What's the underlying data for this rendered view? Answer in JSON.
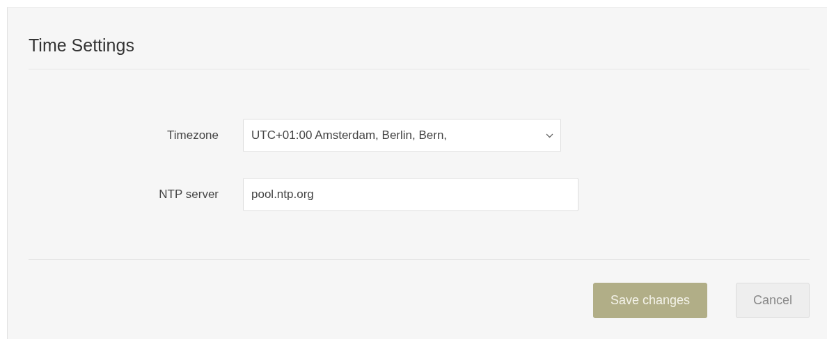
{
  "title": "Time Settings",
  "fields": [
    {
      "kind": "select",
      "label": "Timezone",
      "value": "UTC+01:00 Amsterdam, Berlin, Bern,"
    },
    {
      "kind": "text",
      "label": "NTP server",
      "value": "pool.ntp.org"
    }
  ],
  "buttons": [
    {
      "label": "Save changes",
      "kind": "primary"
    },
    {
      "label": "Cancel",
      "kind": "secondary"
    }
  ]
}
